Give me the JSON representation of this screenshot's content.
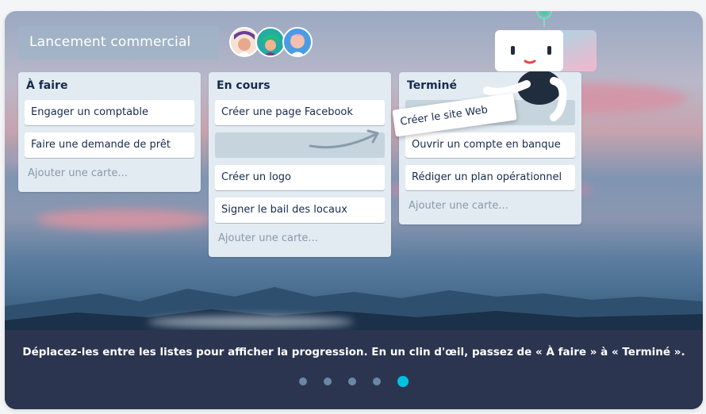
{
  "board": {
    "title": "Lancement commercial"
  },
  "members": [
    {
      "icon": "avatar-1"
    },
    {
      "icon": "avatar-2"
    },
    {
      "icon": "avatar-3"
    }
  ],
  "lists": [
    {
      "title": "À faire",
      "cards": [
        "Engager un comptable",
        "Faire une demande de prêt"
      ],
      "add_card": "Ajouter une carte..."
    },
    {
      "title": "En cours",
      "cards": [
        "Créer une page Facebook",
        "Créer un logo",
        "Signer le bail des locaux"
      ],
      "add_card": "Ajouter une carte..."
    },
    {
      "title": "Terminé",
      "cards": [
        "Ouvrir un compte en banque",
        "Rédiger un plan opérationnel"
      ],
      "add_card": "Ajouter une carte..."
    }
  ],
  "dragged_card": "Créer le site Web",
  "caption": "Déplacez-les entre les listes pour afficher la progression. En un clin d'œil, passez de « À faire » à « Terminé ».",
  "carousel": {
    "total": 5,
    "active_index": 4
  },
  "colors": {
    "accent": "#00c2e0",
    "footer": "#2b3550",
    "list_bg": "#e2ebf2",
    "title_text": "#172b4d"
  }
}
